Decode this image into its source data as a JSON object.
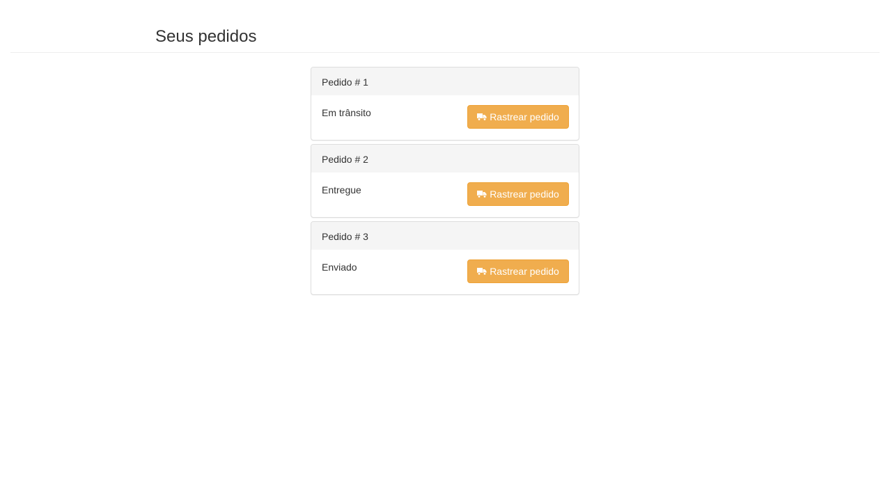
{
  "page": {
    "title": "Seus pedidos"
  },
  "orders": [
    {
      "heading": "Pedido # 1",
      "status": "Em trânsito",
      "action_label": "Rastrear pedido"
    },
    {
      "heading": "Pedido # 2",
      "status": "Entregue",
      "action_label": "Rastrear pedido"
    },
    {
      "heading": "Pedido # 3",
      "status": "Enviado",
      "action_label": "Rastrear pedido"
    }
  ],
  "icons": {
    "track": "truck-icon"
  },
  "colors": {
    "button_background": "#f0ad4e",
    "button_border": "#eea236",
    "panel_heading_background": "#f5f5f5"
  }
}
